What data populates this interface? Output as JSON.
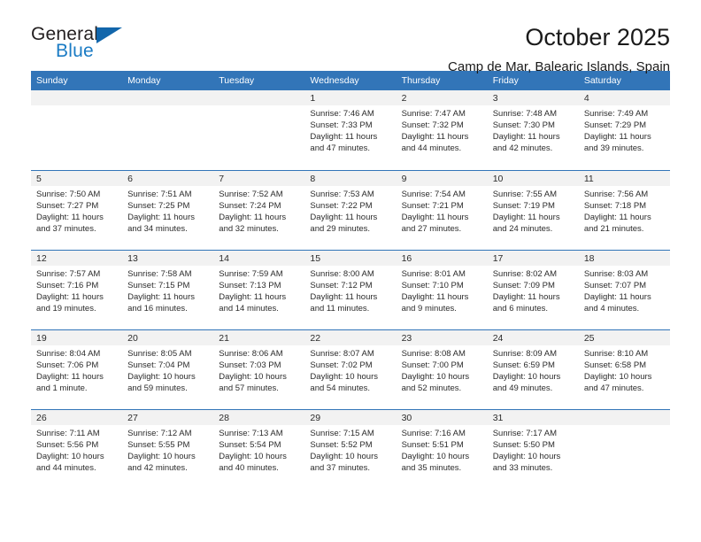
{
  "logo": {
    "word_one": "General",
    "word_two": "Blue",
    "triangle_color": "#1266ab",
    "blue_text_color": "#1a7bc4"
  },
  "header": {
    "title": "October 2025",
    "subtitle": "Camp de Mar, Balearic Islands, Spain"
  },
  "theme": {
    "header_blue": "#3275b8",
    "daynum_band": "#f2f2f2",
    "text": "#2b2b2b"
  },
  "weekday_headers": [
    "Sunday",
    "Monday",
    "Tuesday",
    "Wednesday",
    "Thursday",
    "Friday",
    "Saturday"
  ],
  "weeks": [
    [
      {
        "day": "",
        "sunrise": "",
        "sunset": "",
        "daylight": ""
      },
      {
        "day": "",
        "sunrise": "",
        "sunset": "",
        "daylight": ""
      },
      {
        "day": "",
        "sunrise": "",
        "sunset": "",
        "daylight": ""
      },
      {
        "day": "1",
        "sunrise": "Sunrise: 7:46 AM",
        "sunset": "Sunset: 7:33 PM",
        "daylight": "Daylight: 11 hours and 47 minutes."
      },
      {
        "day": "2",
        "sunrise": "Sunrise: 7:47 AM",
        "sunset": "Sunset: 7:32 PM",
        "daylight": "Daylight: 11 hours and 44 minutes."
      },
      {
        "day": "3",
        "sunrise": "Sunrise: 7:48 AM",
        "sunset": "Sunset: 7:30 PM",
        "daylight": "Daylight: 11 hours and 42 minutes."
      },
      {
        "day": "4",
        "sunrise": "Sunrise: 7:49 AM",
        "sunset": "Sunset: 7:29 PM",
        "daylight": "Daylight: 11 hours and 39 minutes."
      }
    ],
    [
      {
        "day": "5",
        "sunrise": "Sunrise: 7:50 AM",
        "sunset": "Sunset: 7:27 PM",
        "daylight": "Daylight: 11 hours and 37 minutes."
      },
      {
        "day": "6",
        "sunrise": "Sunrise: 7:51 AM",
        "sunset": "Sunset: 7:25 PM",
        "daylight": "Daylight: 11 hours and 34 minutes."
      },
      {
        "day": "7",
        "sunrise": "Sunrise: 7:52 AM",
        "sunset": "Sunset: 7:24 PM",
        "daylight": "Daylight: 11 hours and 32 minutes."
      },
      {
        "day": "8",
        "sunrise": "Sunrise: 7:53 AM",
        "sunset": "Sunset: 7:22 PM",
        "daylight": "Daylight: 11 hours and 29 minutes."
      },
      {
        "day": "9",
        "sunrise": "Sunrise: 7:54 AM",
        "sunset": "Sunset: 7:21 PM",
        "daylight": "Daylight: 11 hours and 27 minutes."
      },
      {
        "day": "10",
        "sunrise": "Sunrise: 7:55 AM",
        "sunset": "Sunset: 7:19 PM",
        "daylight": "Daylight: 11 hours and 24 minutes."
      },
      {
        "day": "11",
        "sunrise": "Sunrise: 7:56 AM",
        "sunset": "Sunset: 7:18 PM",
        "daylight": "Daylight: 11 hours and 21 minutes."
      }
    ],
    [
      {
        "day": "12",
        "sunrise": "Sunrise: 7:57 AM",
        "sunset": "Sunset: 7:16 PM",
        "daylight": "Daylight: 11 hours and 19 minutes."
      },
      {
        "day": "13",
        "sunrise": "Sunrise: 7:58 AM",
        "sunset": "Sunset: 7:15 PM",
        "daylight": "Daylight: 11 hours and 16 minutes."
      },
      {
        "day": "14",
        "sunrise": "Sunrise: 7:59 AM",
        "sunset": "Sunset: 7:13 PM",
        "daylight": "Daylight: 11 hours and 14 minutes."
      },
      {
        "day": "15",
        "sunrise": "Sunrise: 8:00 AM",
        "sunset": "Sunset: 7:12 PM",
        "daylight": "Daylight: 11 hours and 11 minutes."
      },
      {
        "day": "16",
        "sunrise": "Sunrise: 8:01 AM",
        "sunset": "Sunset: 7:10 PM",
        "daylight": "Daylight: 11 hours and 9 minutes."
      },
      {
        "day": "17",
        "sunrise": "Sunrise: 8:02 AM",
        "sunset": "Sunset: 7:09 PM",
        "daylight": "Daylight: 11 hours and 6 minutes."
      },
      {
        "day": "18",
        "sunrise": "Sunrise: 8:03 AM",
        "sunset": "Sunset: 7:07 PM",
        "daylight": "Daylight: 11 hours and 4 minutes."
      }
    ],
    [
      {
        "day": "19",
        "sunrise": "Sunrise: 8:04 AM",
        "sunset": "Sunset: 7:06 PM",
        "daylight": "Daylight: 11 hours and 1 minute."
      },
      {
        "day": "20",
        "sunrise": "Sunrise: 8:05 AM",
        "sunset": "Sunset: 7:04 PM",
        "daylight": "Daylight: 10 hours and 59 minutes."
      },
      {
        "day": "21",
        "sunrise": "Sunrise: 8:06 AM",
        "sunset": "Sunset: 7:03 PM",
        "daylight": "Daylight: 10 hours and 57 minutes."
      },
      {
        "day": "22",
        "sunrise": "Sunrise: 8:07 AM",
        "sunset": "Sunset: 7:02 PM",
        "daylight": "Daylight: 10 hours and 54 minutes."
      },
      {
        "day": "23",
        "sunrise": "Sunrise: 8:08 AM",
        "sunset": "Sunset: 7:00 PM",
        "daylight": "Daylight: 10 hours and 52 minutes."
      },
      {
        "day": "24",
        "sunrise": "Sunrise: 8:09 AM",
        "sunset": "Sunset: 6:59 PM",
        "daylight": "Daylight: 10 hours and 49 minutes."
      },
      {
        "day": "25",
        "sunrise": "Sunrise: 8:10 AM",
        "sunset": "Sunset: 6:58 PM",
        "daylight": "Daylight: 10 hours and 47 minutes."
      }
    ],
    [
      {
        "day": "26",
        "sunrise": "Sunrise: 7:11 AM",
        "sunset": "Sunset: 5:56 PM",
        "daylight": "Daylight: 10 hours and 44 minutes."
      },
      {
        "day": "27",
        "sunrise": "Sunrise: 7:12 AM",
        "sunset": "Sunset: 5:55 PM",
        "daylight": "Daylight: 10 hours and 42 minutes."
      },
      {
        "day": "28",
        "sunrise": "Sunrise: 7:13 AM",
        "sunset": "Sunset: 5:54 PM",
        "daylight": "Daylight: 10 hours and 40 minutes."
      },
      {
        "day": "29",
        "sunrise": "Sunrise: 7:15 AM",
        "sunset": "Sunset: 5:52 PM",
        "daylight": "Daylight: 10 hours and 37 minutes."
      },
      {
        "day": "30",
        "sunrise": "Sunrise: 7:16 AM",
        "sunset": "Sunset: 5:51 PM",
        "daylight": "Daylight: 10 hours and 35 minutes."
      },
      {
        "day": "31",
        "sunrise": "Sunrise: 7:17 AM",
        "sunset": "Sunset: 5:50 PM",
        "daylight": "Daylight: 10 hours and 33 minutes."
      },
      {
        "day": "",
        "sunrise": "",
        "sunset": "",
        "daylight": ""
      }
    ]
  ]
}
